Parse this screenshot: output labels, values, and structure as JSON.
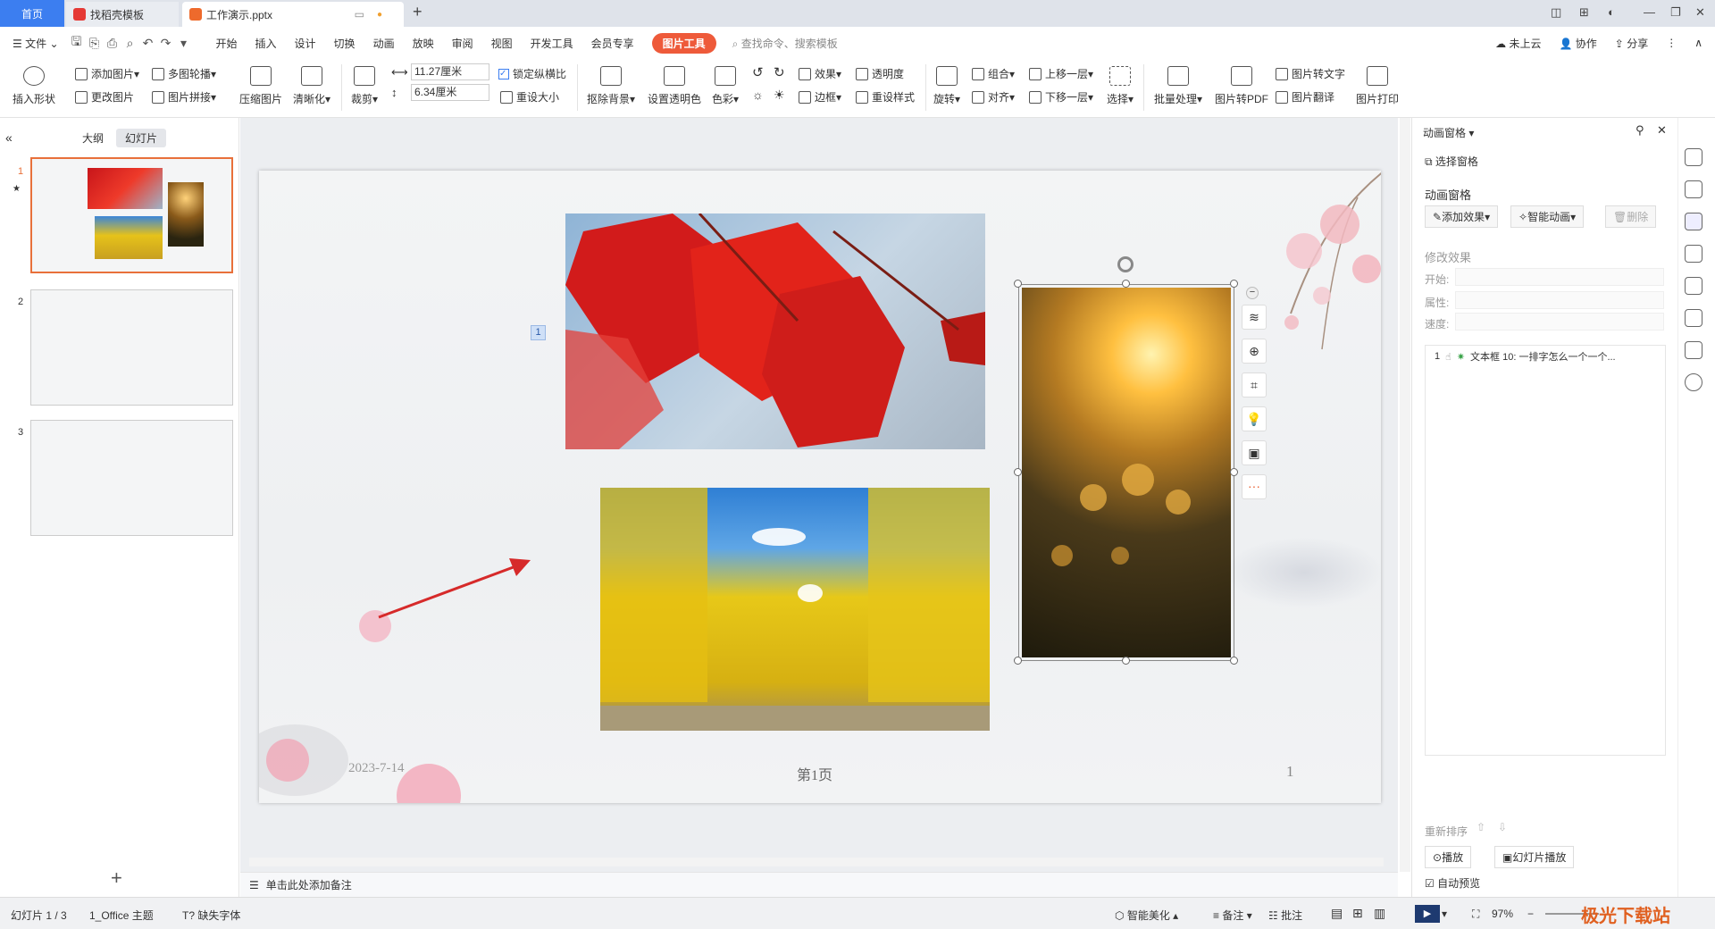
{
  "tabs": {
    "home": "首页",
    "template": "找稻壳模板",
    "document": "工作演示.pptx"
  },
  "menu": {
    "file": "文件",
    "items": [
      "开始",
      "插入",
      "设计",
      "切换",
      "动画",
      "放映",
      "审阅",
      "视图",
      "开发工具",
      "会员专享"
    ],
    "picture_tools": "图片工具",
    "search_placeholder": "查找命令、搜索模板",
    "cloud": "未上云",
    "collab": "协作",
    "share": "分享"
  },
  "ribbon": {
    "insert_shape": "插入形状",
    "add_picture": "添加图片",
    "multi_round": "多图轮播",
    "change_picture": "更改图片",
    "picture_splice": "图片拼接",
    "compress": "压缩图片",
    "clarity": "清晰化",
    "crop": "裁剪",
    "width": "11.27厘米",
    "height": "6.34厘米",
    "lock_ratio": "锁定纵横比",
    "reset_size": "重设大小",
    "remove_bg": "抠除背景",
    "set_transparent": "设置透明色",
    "color": "色彩",
    "effect": "效果",
    "transparency": "透明度",
    "border": "边框",
    "reset_style": "重设样式",
    "rotate": "旋转",
    "group": "组合",
    "align": "对齐",
    "bring_forward": "上移一层",
    "send_backward": "下移一层",
    "select": "选择",
    "batch": "批量处理",
    "to_pdf": "图片转PDF",
    "to_text": "图片转文字",
    "translate": "图片翻译",
    "print": "图片打印"
  },
  "left_panel": {
    "outline_tab": "大纲",
    "slides_tab": "幻灯片",
    "slides": [
      "1",
      "2",
      "3"
    ]
  },
  "slide": {
    "anim_tag": "1",
    "date": "2023-7-14",
    "page_label": "第1页",
    "page_number": "1"
  },
  "right_panel": {
    "title": "动画窗格",
    "select_pane": "选择窗格",
    "anim_pane": "动画窗格",
    "add_effect": "添加效果",
    "smart_anim": "智能动画",
    "delete": "删除",
    "modify_effect": "修改效果",
    "start_label": "开始:",
    "property_label": "属性:",
    "speed_label": "速度:",
    "anim_item": "文本框 10: 一排字怎么一个一个...",
    "anim_item_index": "1",
    "reorder": "重新排序",
    "play": "播放",
    "slide_play": "幻灯片播放",
    "auto_preview": "自动预览"
  },
  "notes": {
    "placeholder": "单击此处添加备注"
  },
  "status": {
    "slide_count": "幻灯片 1 / 3",
    "theme": "1_Office 主题",
    "missing_font": "缺失字体",
    "smart_beautify": "智能美化",
    "notes": "备注",
    "comment": "批注",
    "zoom": "97%"
  },
  "watermark": "极光下载站"
}
